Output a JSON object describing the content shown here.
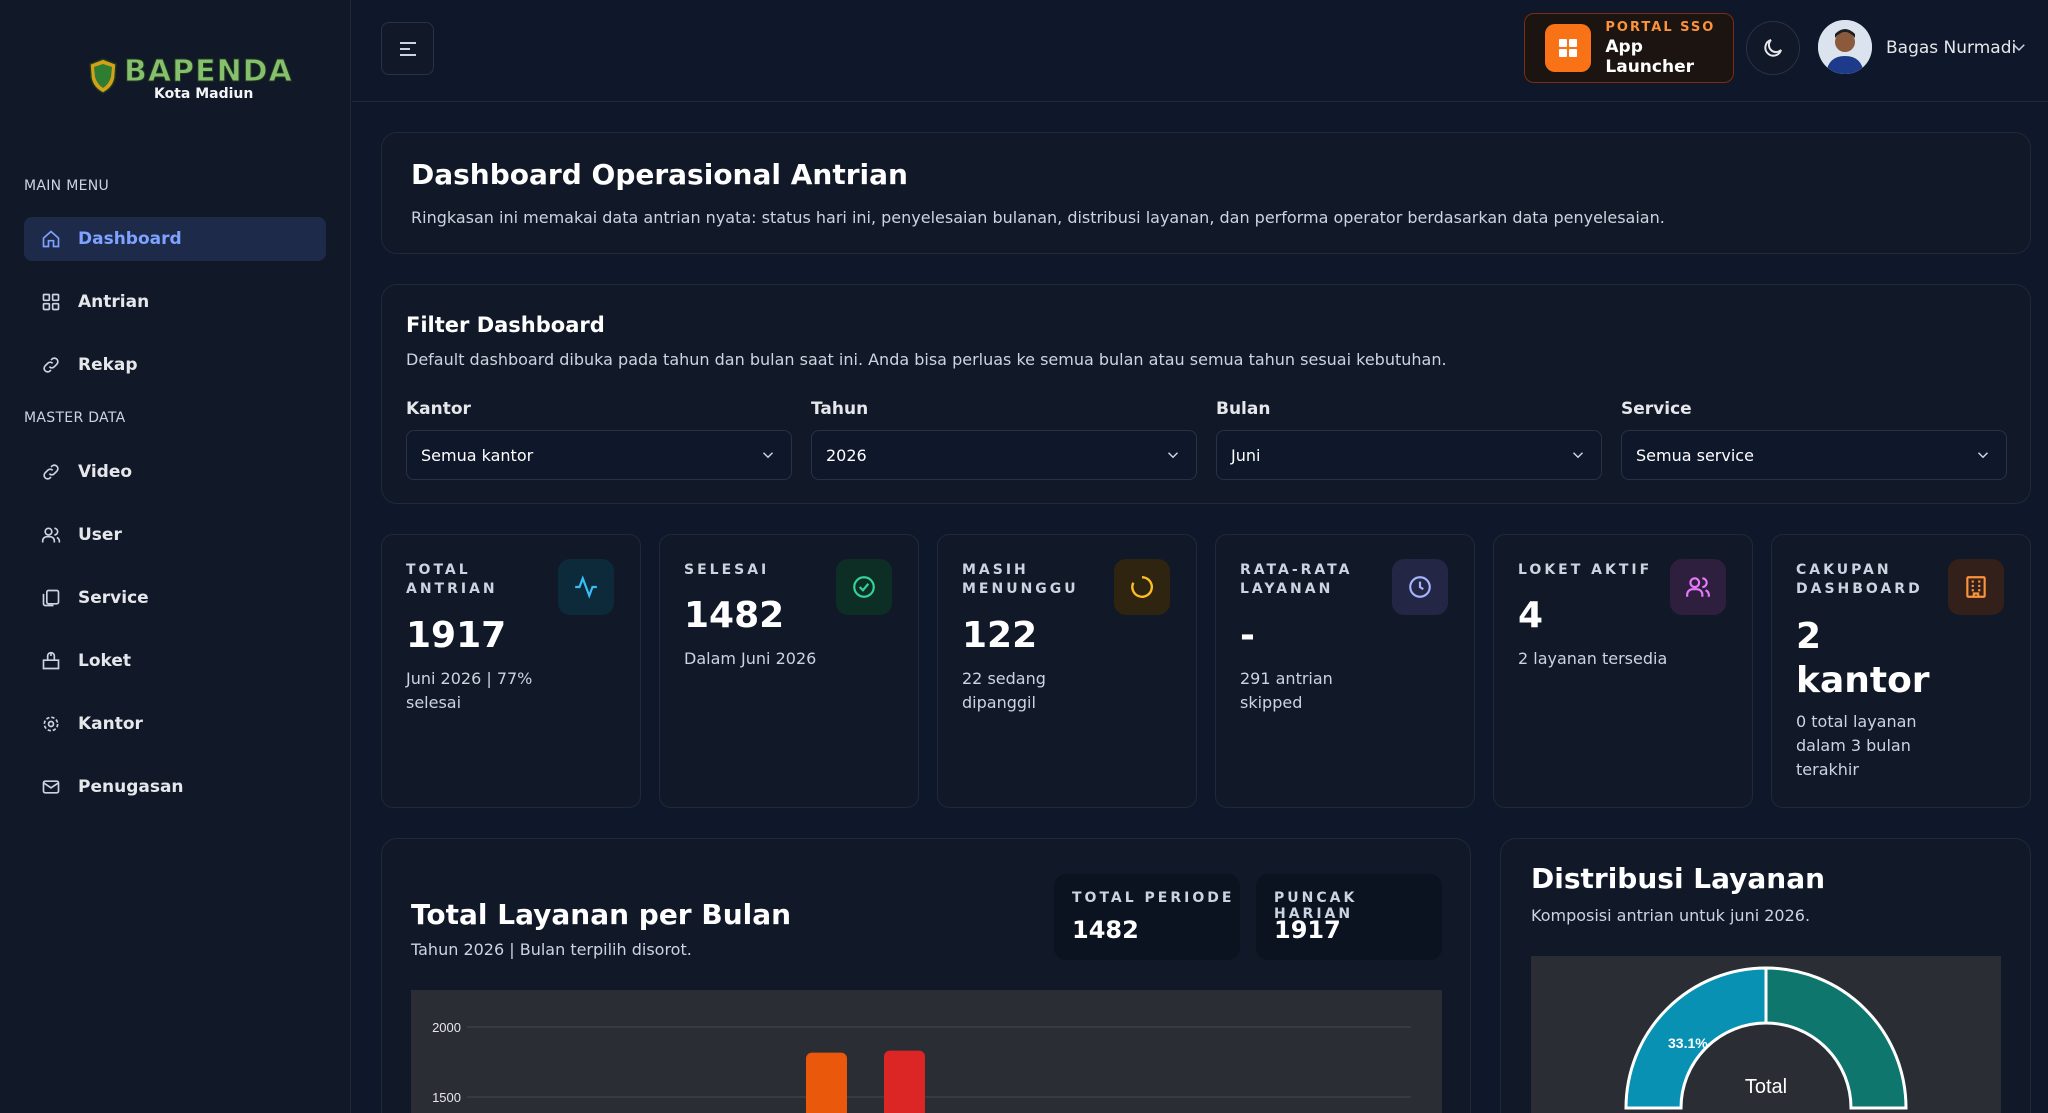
{
  "sidebar": {
    "logo_text": "BAPENDA",
    "logo_sub": "Kota Madiun",
    "main_menu_label": "MAIN MENU",
    "master_data_label": "MASTER DATA",
    "items": [
      {
        "label": "Dashboard",
        "icon": "home-icon",
        "active": true
      },
      {
        "label": "Antrian",
        "icon": "grid-icon"
      },
      {
        "label": "Rekap",
        "icon": "link-icon"
      },
      {
        "label": "Video",
        "icon": "link-icon"
      },
      {
        "label": "User",
        "icon": "users-icon"
      },
      {
        "label": "Service",
        "icon": "copy-icon"
      },
      {
        "label": "Loket",
        "icon": "counter-icon"
      },
      {
        "label": "Kantor",
        "icon": "gear-icon"
      },
      {
        "label": "Penugasan",
        "icon": "mail-icon"
      }
    ]
  },
  "topbar": {
    "portal_label": "PORTAL SSO",
    "portal_title": "App Launcher",
    "user_name": "Bagas Nurmadi"
  },
  "hero": {
    "title": "Dashboard Operasional Antrian",
    "subtitle": "Ringkasan ini memakai data antrian nyata: status hari ini, penyelesaian bulanan, distribusi layanan, dan performa operator berdasarkan data penyelesaian."
  },
  "filter": {
    "title": "Filter Dashboard",
    "subtitle": "Default dashboard dibuka pada tahun dan bulan saat ini. Anda bisa perluas ke semua bulan atau semua tahun sesuai kebutuhan.",
    "fields": [
      {
        "label": "Kantor",
        "value": "Semua kantor"
      },
      {
        "label": "Tahun",
        "value": "2026"
      },
      {
        "label": "Bulan",
        "value": "Juni"
      },
      {
        "label": "Service",
        "value": "Semua service"
      }
    ]
  },
  "stats": [
    {
      "label": "TOTAL ANTRIAN",
      "value": "1917",
      "note": "Juni 2026 | 77% selesai",
      "icon": "activity-icon"
    },
    {
      "label": "SELESAI",
      "value": "1482",
      "note": "Dalam Juni 2026",
      "icon": "check-circle-icon"
    },
    {
      "label": "MASIH MENUNGGU",
      "value": "122",
      "note": "22 sedang dipanggil",
      "icon": "loading-icon"
    },
    {
      "label": "RATA-RATA LAYANAN",
      "value": "-",
      "note": "291 antrian skipped",
      "icon": "clock-icon"
    },
    {
      "label": "LOKET AKTIF",
      "value": "4",
      "note": "2 layanan tersedia",
      "icon": "users-icon"
    },
    {
      "label": "CAKUPAN DASHBOARD",
      "value": "2 kantor",
      "note": "0 total layanan dalam 3 bulan terakhir",
      "icon": "building-icon"
    }
  ],
  "monthly": {
    "title": "Total Layanan per Bulan",
    "subtitle": "Tahun 2026 | Bulan terpilih disorot.",
    "total_label": "TOTAL PERIODE",
    "total_value": "1482",
    "peak_label": "PUNCAK HARIAN",
    "peak_value": "1917"
  },
  "distribution": {
    "title": "Distribusi Layanan",
    "subtitle": "Komposisi antrian untuk juni 2026.",
    "center_label": "Total",
    "slice_label": "33.1%"
  },
  "chart_data": {
    "type": "bar",
    "y_ticks": [
      "2000",
      "1500"
    ],
    "ylim": [
      1500,
      2000
    ],
    "series": [
      {
        "values": [
          1917
        ],
        "color": "#ea580c"
      },
      {
        "values": [
          1917
        ],
        "color": "#dc2626"
      }
    ],
    "colors": {
      "bar1": "#ea580c",
      "bar2": "#dc2626",
      "grid": "#44474e"
    }
  }
}
